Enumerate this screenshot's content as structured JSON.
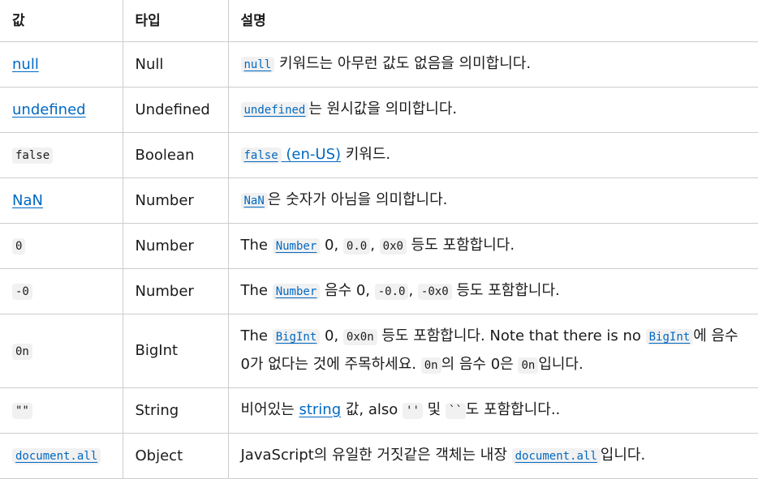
{
  "headers": {
    "value": "값",
    "type": "타입",
    "description": "설명"
  },
  "rows": [
    {
      "value": "null",
      "type": "Null",
      "desc": {
        "code": "null",
        "text": " 키워드는 아무런 값도 없음을 의미합니다."
      }
    },
    {
      "value": "undefined",
      "type": "Undefined",
      "desc": {
        "code": "undefined",
        "text": "는 원시값을 의미합니다."
      }
    },
    {
      "value": "false",
      "type": "Boolean",
      "desc": {
        "code": "false",
        "locale": "(en-US)",
        "text": " 키워드."
      }
    },
    {
      "value": "NaN",
      "type": "Number",
      "desc": {
        "code": "NaN",
        "text": "은 숫자가 아님을 의미합니다."
      }
    },
    {
      "value": "0",
      "type": "Number",
      "desc": {
        "the": "The ",
        "code": "Number",
        "t1": " 0, ",
        "c1": "0.0",
        "t2": ", ",
        "c2": "0x0",
        "t3": " 등도 포함합니다."
      }
    },
    {
      "value": "-0",
      "type": "Number",
      "desc": {
        "the": "The ",
        "code": "Number",
        "t1": " 음수 0, ",
        "c1": "-0.0",
        "t2": ", ",
        "c2": "-0x0",
        "t3": " 등도 포함합니다."
      }
    },
    {
      "value": "0n",
      "type": "BigInt",
      "desc": {
        "the": "The ",
        "code": "BigInt",
        "t1": " 0, ",
        "c1": "0x0n",
        "t2": " 등도 포함합니다. Note that there is no ",
        "code2": "BigInt",
        "t3": "에 음수 0가 없다는 것에 주목하세요. ",
        "c2": "0n",
        "t4": "의 음수 0은 ",
        "c3": "0n",
        "t5": "입니다."
      }
    },
    {
      "value": "\"\"",
      "type": "String",
      "desc": {
        "t1": "비어있는 ",
        "link": "string",
        "t2": " 값, also ",
        "c1": "''",
        "t3": " 및 ",
        "c2": "``",
        "t4": "도 포함합니다.."
      }
    },
    {
      "value": "document.all",
      "type": "Object",
      "desc": {
        "t1": "JavaScript의 유일한 거짓같은 객체는 내장 ",
        "code": "document.all",
        "t2": "입니다."
      }
    }
  ]
}
